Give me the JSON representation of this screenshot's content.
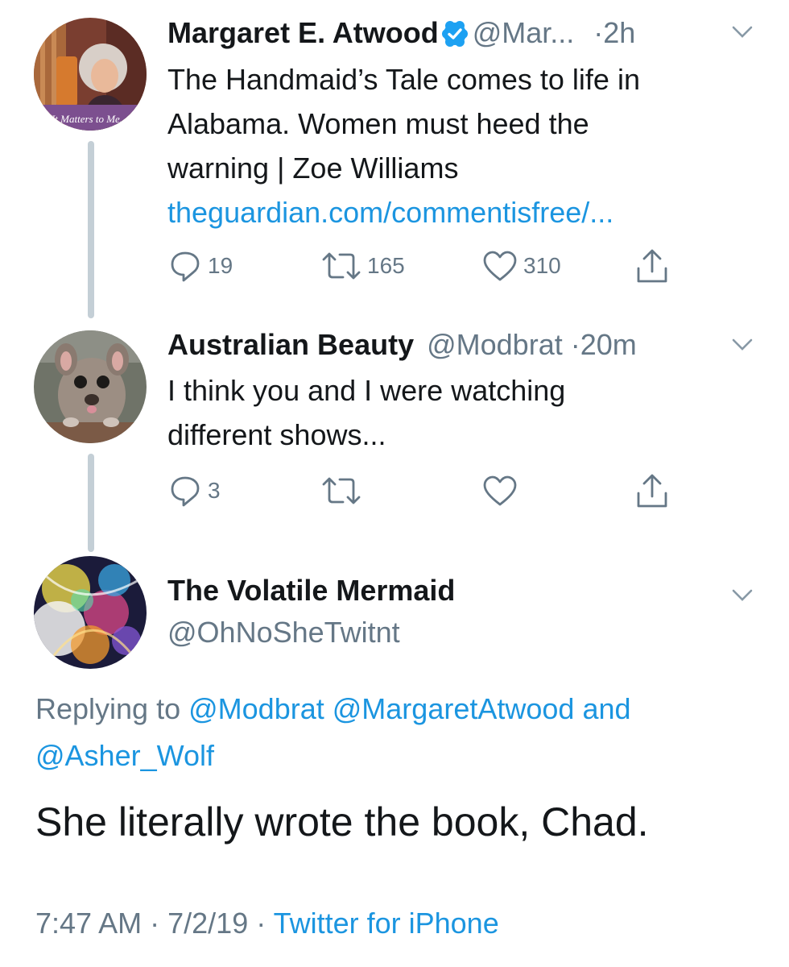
{
  "thread": [
    {
      "name": "Margaret E. Atwood",
      "handle": "@Mar...",
      "time": "2h",
      "avatar_caption": "It Matters to Me.",
      "text_lines": [
        "The Handmaid’s Tale comes to life in",
        "Alabama. Women must heed the",
        "warning | Zoe Williams"
      ],
      "link": "theguardian.com/commentisfree/...",
      "replies": "19",
      "retweets": "165",
      "likes": "310",
      "verified": true
    },
    {
      "name": "Australian Beauty",
      "handle": "@Modbrat",
      "time": "20m",
      "text_lines": [
        "I think you and I were watching",
        "different shows..."
      ],
      "replies": "3"
    }
  ],
  "main_tweet": {
    "name": "The Volatile Mermaid",
    "handle": "@OhNoSheTwitnt",
    "replying_prefix": "Replying to",
    "mention_1": "@Modbrat",
    "mention_2": "@MargaretAtwood",
    "and_text": "and",
    "mention_3": "@Asher_Wolf",
    "text": "She literally wrote the book, Chad.",
    "time": "7:47 AM",
    "date": "7/2/19",
    "source": "Twitter for iPhone"
  },
  "separator": "·",
  "icons": {
    "reply": "reply-icon",
    "retweet": "retweet-icon",
    "like": "heart-icon",
    "share": "share-icon",
    "caret": "chevron-down-icon",
    "verified": "verified-badge-icon"
  },
  "colors": {
    "text": "#14171a",
    "secondary": "#657786",
    "link": "#1b95e0",
    "thread_line": "#c4cfd6"
  }
}
